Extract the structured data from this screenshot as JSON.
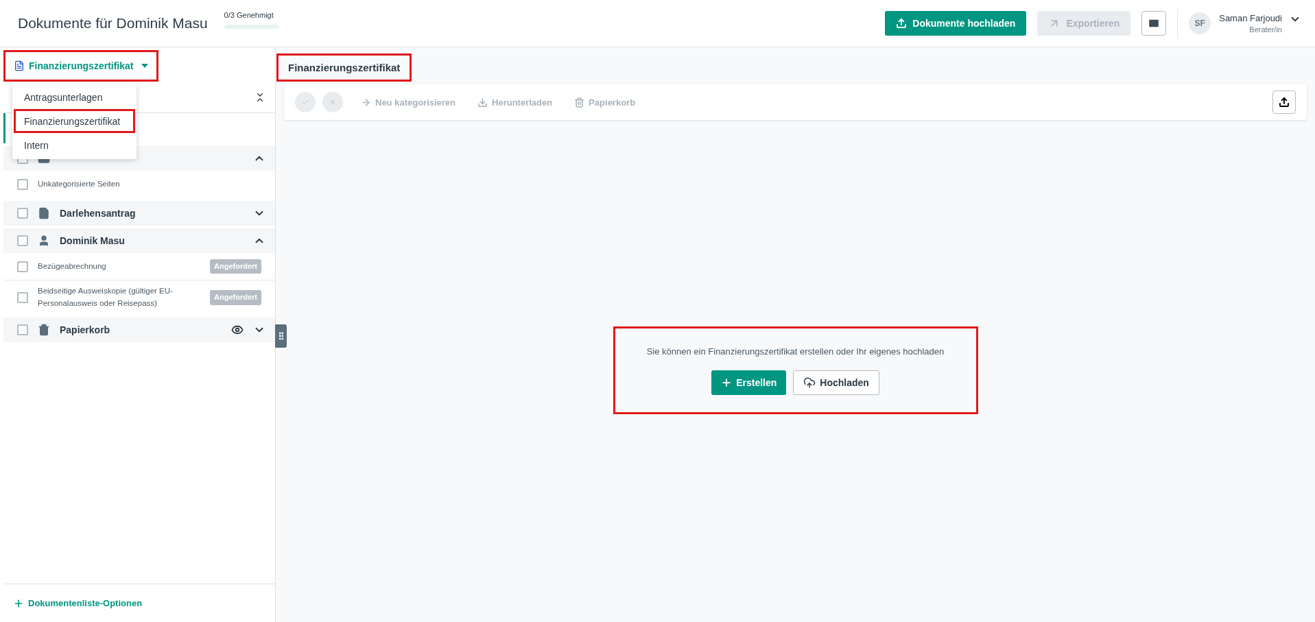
{
  "header": {
    "title": "Dokumente für Dominik Masu",
    "approval": {
      "text": "0/3 Genehmigt",
      "level": 0
    },
    "buttons": [
      {
        "label": "Dokumente hochladen",
        "kind": "primary",
        "disabled": false
      },
      {
        "label": "Exportieren",
        "kind": "secondary",
        "disabled": true
      }
    ],
    "user": {
      "initials": "SF",
      "name": "Saman Farjoudi",
      "role": "Berater/in"
    }
  },
  "sidebar": {
    "selector": {
      "label": "Finanzierungszertifikat",
      "highlighted": true
    },
    "menu": [
      {
        "label": "Antragsunterlagen",
        "highlighted": false
      },
      {
        "label": "Finanzierungszertifikat",
        "highlighted": true
      },
      {
        "label": "Intern",
        "highlighted": false
      }
    ],
    "current_row": {
      "selected": true
    },
    "groups": [
      {
        "checked": false,
        "expanded": true,
        "items": [
          {
            "label": "Unkategorisierte Seiten",
            "checked": false
          }
        ]
      },
      {
        "label": "Darlehensantrag",
        "checked": false,
        "expanded": false
      },
      {
        "label": "Dominik Masu",
        "checked": false,
        "expanded": true,
        "items": [
          {
            "label": "Bezügeabrechnung",
            "checked": false,
            "badge": "Angefordert"
          },
          {
            "label": "Beidseitige Ausweiskopie (gültiger EU-Personalausweis oder Reisepass)",
            "checked": false,
            "badge": "Angefordert"
          }
        ]
      },
      {
        "label": "Papierkorb",
        "checked": false,
        "expanded": false,
        "visible": true
      }
    ],
    "footer_link": "Dokumentenliste-Optionen"
  },
  "main": {
    "title": {
      "text": "Finanzierungszertifikat",
      "highlighted": true
    },
    "toolbar": [
      {
        "label": "Neu kategorisieren"
      },
      {
        "label": "Herunterladen"
      },
      {
        "label": "Papierkorb"
      }
    ],
    "empty_state": {
      "message": "Sie können ein Finanzierungszertifikat erstellen oder Ihr eigenes hochladen",
      "highlighted": true,
      "buttons": [
        {
          "label": "Erstellen",
          "kind": "primary"
        },
        {
          "label": "Hochladen",
          "kind": "secondary"
        }
      ]
    }
  }
}
